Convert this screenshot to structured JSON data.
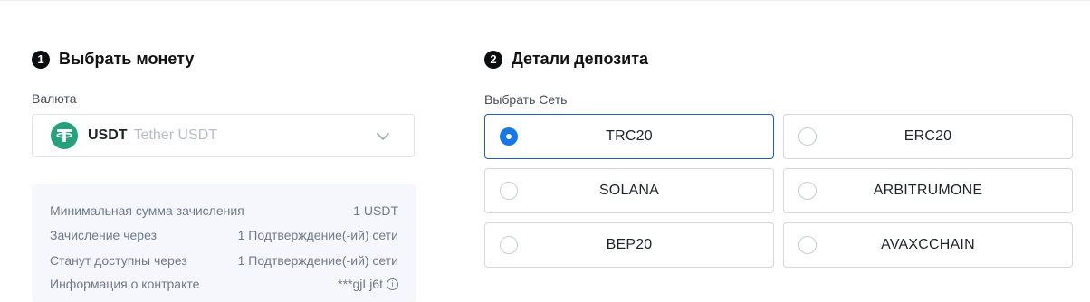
{
  "left_section": {
    "step_number": "1",
    "title": "Выбрать монету",
    "currency_label": "Валюта",
    "selected_coin": {
      "symbol": "USDT",
      "name": "Tether USDT",
      "icon": "tether-icon",
      "icon_color": "#26a17b"
    },
    "info_rows": [
      {
        "label": "Минимальная сумма зачисления",
        "value": "1 USDT"
      },
      {
        "label": "Зачисление через",
        "value": "1 Подтверждение(-ий) сети"
      },
      {
        "label": "Станут доступны через",
        "value": "1 Подтверждение(-ий) сети"
      },
      {
        "label": "Информация о контракте",
        "value": "***gjLj6t"
      }
    ]
  },
  "right_section": {
    "step_number": "2",
    "title": "Детали депозита",
    "network_label": "Выбрать Сеть",
    "networks": [
      {
        "label": "TRC20",
        "selected": true
      },
      {
        "label": "ERC20",
        "selected": false
      },
      {
        "label": "SOLANA",
        "selected": false
      },
      {
        "label": "ARBITRUMONE",
        "selected": false
      },
      {
        "label": "BEP20",
        "selected": false
      },
      {
        "label": "AVAXCCHAIN",
        "selected": false
      }
    ]
  },
  "colors": {
    "accent": "#1677e6",
    "selected_border": "#1f5fb3",
    "info_background": "#f5f7fc"
  }
}
